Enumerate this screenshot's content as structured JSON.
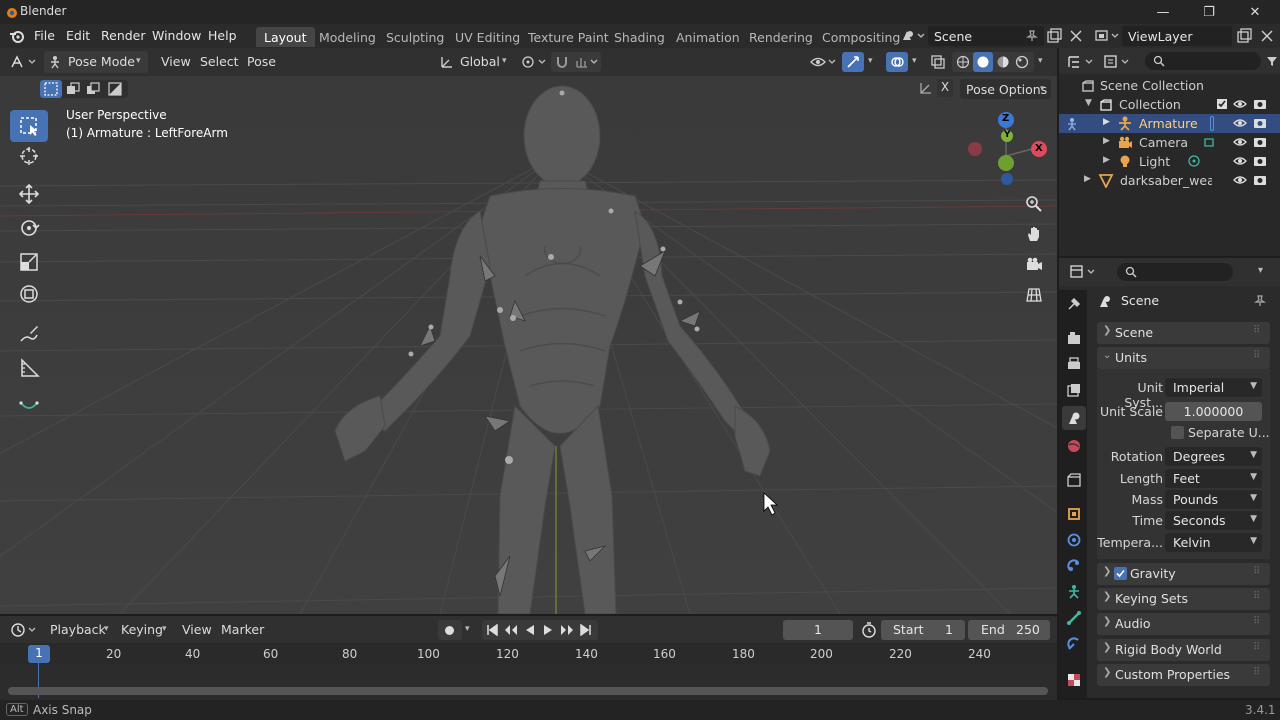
{
  "titlebar": {
    "title": "Blender",
    "minimize": "—",
    "maximize": "❐",
    "close": "✕"
  },
  "menu": {
    "file": "File",
    "edit": "Edit",
    "render": "Render",
    "window": "Window",
    "help": "Help"
  },
  "workspaces": [
    "Layout",
    "Modeling",
    "Sculpting",
    "UV Editing",
    "Texture Paint",
    "Shading",
    "Animation",
    "Rendering",
    "Compositing"
  ],
  "active_workspace": "Layout",
  "scene_field": "Scene",
  "viewlayer_field": "ViewLayer",
  "viewport_header": {
    "mode": "Pose Mode",
    "view": "View",
    "select": "Select",
    "pose": "Pose",
    "orientation": "Global",
    "pose_options": "Pose Options"
  },
  "viewport_overlay": {
    "perspective": "User Perspective",
    "object_info": "(1) Armature : LeftForeArm"
  },
  "gizmo": {
    "x": "X",
    "y": "Y",
    "z": "Z"
  },
  "outliner": {
    "scene_collection": "Scene Collection",
    "collection": "Collection",
    "items": [
      "Armature",
      "Camera",
      "Light",
      "darksaber_weapo"
    ]
  },
  "properties": {
    "context": "Scene",
    "panels": {
      "scene": "Scene",
      "units": "Units",
      "gravity": "Gravity",
      "keying_sets": "Keying Sets",
      "audio": "Audio",
      "rigid_body_world": "Rigid Body World",
      "custom_properties": "Custom Properties"
    },
    "units": {
      "unit_system_label": "Unit Syst...",
      "unit_system": "Imperial",
      "unit_scale_label": "Unit Scale",
      "unit_scale": "1.000000",
      "separate_units": "Separate U...",
      "rotation_label": "Rotation",
      "rotation": "Degrees",
      "length_label": "Length",
      "length": "Feet",
      "mass_label": "Mass",
      "mass": "Pounds",
      "time_label": "Time",
      "time": "Seconds",
      "temperature_label": "Tempera...",
      "temperature": "Kelvin"
    },
    "gravity_checked": true,
    "separate_units_checked": false
  },
  "timeline": {
    "playback": "Playback",
    "keying": "Keying",
    "view": "View",
    "marker": "Marker",
    "current_frame": "1",
    "start_label": "Start",
    "start": "1",
    "end_label": "End",
    "end": "250",
    "ruler": [
      "20",
      "40",
      "60",
      "80",
      "100",
      "120",
      "140",
      "160",
      "180",
      "200",
      "220",
      "240"
    ],
    "playhead": "1"
  },
  "status": {
    "key": "Alt",
    "hint": "Axis Snap",
    "version": "3.4.1"
  },
  "colors": {
    "accent": "#4772b3",
    "x_axis": "#e04a5f",
    "y_axis": "#8bc34a",
    "z_axis": "#4a8be0"
  }
}
